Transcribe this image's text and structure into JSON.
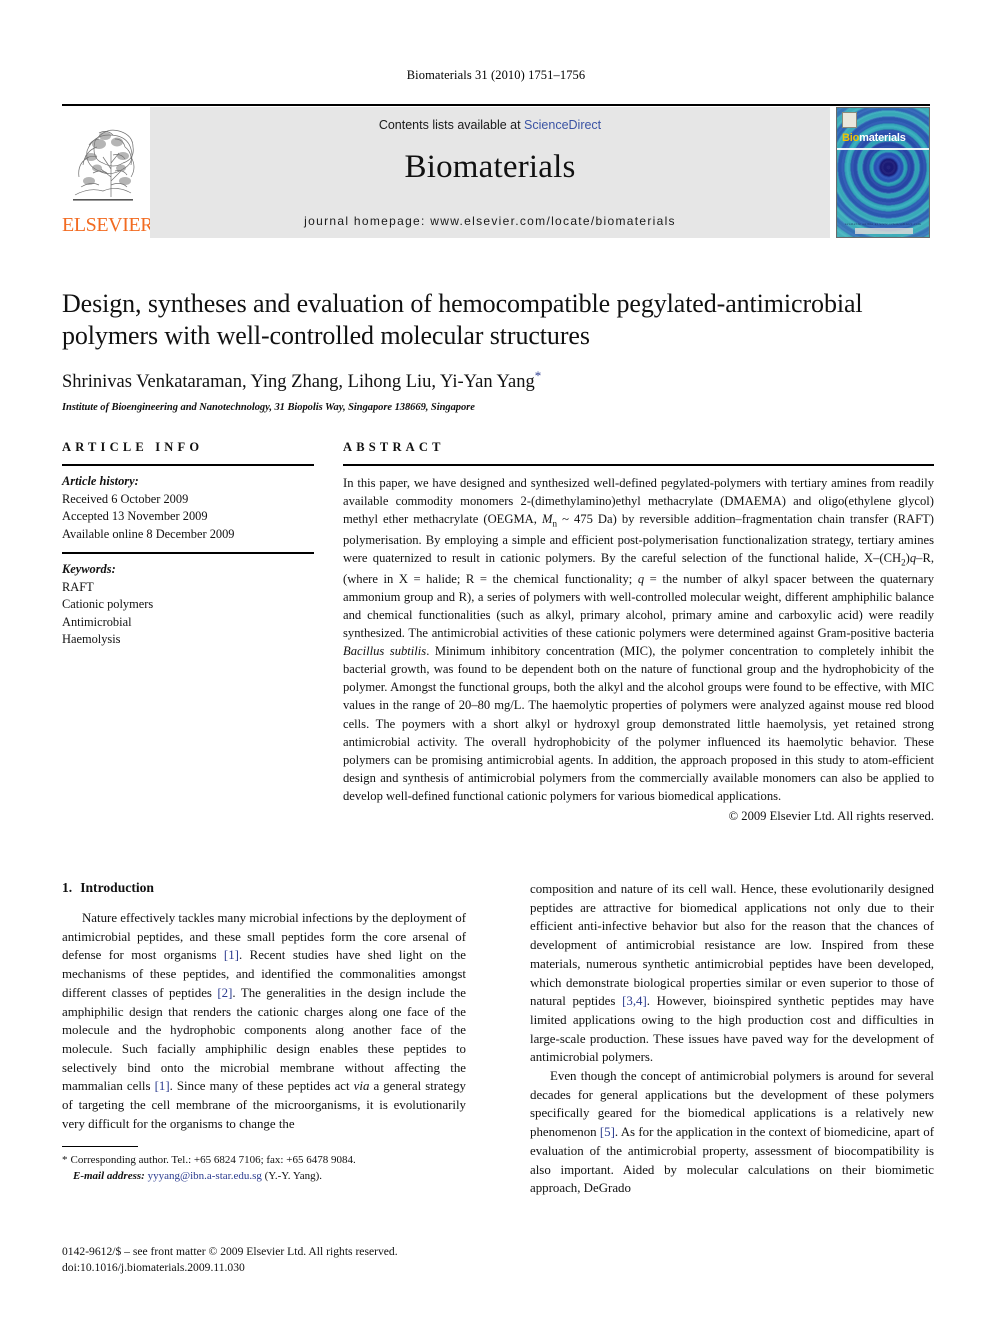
{
  "running_head": "Biomaterials 31 (2010) 1751–1756",
  "masthead": {
    "contents_prefix": "Contents lists available at ",
    "sciencedirect_label": "ScienceDirect",
    "journal_name": "Biomaterials",
    "homepage_label": "journal homepage: www.elsevier.com/locate/biomaterials",
    "publisher_label": "ELSEVIER",
    "cover": {
      "title_part1": "Bio",
      "title_part2": "materials",
      "footer_text": "available online at www.sciencedirect.com"
    },
    "colors": {
      "panel_bg": "#e6e6e6",
      "link": "#3a53a4",
      "elsevier_orange": "#F26B21",
      "cover_teal": "#2f9d9a",
      "cover_gold": "#f2c200"
    }
  },
  "title": "Design, syntheses and evaluation of hemocompatible pegylated-antimicrobial polymers with well-controlled molecular structures",
  "authors": "Shrinivas Venkataraman, Ying Zhang, Lihong Liu, Yi-Yan Yang",
  "corresponding_marker": "*",
  "affiliation": "Institute of Bioengineering and Nanotechnology, 31 Biopolis Way, Singapore 138669, Singapore",
  "article_info": {
    "heading": "ARTICLE INFO",
    "history_label": "Article history:",
    "history": [
      "Received 6 October 2009",
      "Accepted 13 November 2009",
      "Available online 8 December 2009"
    ],
    "keywords_label": "Keywords:",
    "keywords": [
      "RAFT",
      "Cationic polymers",
      "Antimicrobial",
      "Haemolysis"
    ]
  },
  "abstract": {
    "heading": "ABSTRACT",
    "part1": "In this paper, we have designed and synthesized well-defined pegylated-polymers with tertiary amines from readily available commodity monomers 2-(dimethylamino)ethyl methacrylate (DMAEMA) and oligo(ethylene glycol) methyl ether methacrylate (OEGMA, ",
    "mn_symbol": "M",
    "mn_sub": "n",
    "part2": " ~ 475 Da) by reversible addition–fragmentation chain transfer (RAFT) polymerisation. By employing a simple and efficient post-polymerisation functionalization strategy, tertiary amines were quaternized to result in cationic polymers. By the careful selection of the functional halide, X–(CH",
    "ch2_sub": "2",
    "part3": ")",
    "q_italic": "q",
    "part4": "–R, (where in X = halide; R = the chemical functionality; ",
    "q_italic2": "q",
    "part5": " = the number of alkyl spacer between the quaternary ammonium group and R), a series of polymers with well-controlled molecular weight, different amphiphilic balance and chemical functionalities (such as alkyl, primary alcohol, primary amine and carboxylic acid) were readily synthesized. The antimicrobial activities of these cationic polymers were determined against Gram-positive bacteria ",
    "bacillus_italic": "Bacillus subtilis",
    "part6": ". Minimum inhibitory concentration (MIC), the polymer concentration to completely inhibit the bacterial growth, was found to be dependent both on the nature of functional group and the hydrophobicity of the polymer. Amongst the functional groups, both the alkyl and the alcohol groups were found to be effective, with MIC values in the range of 20–80 mg/L. The haemolytic properties of polymers were analyzed against mouse red blood cells. The poymers with a short alkyl or hydroxyl group demonstrated little haemolysis, yet retained strong antimicrobial activity. The overall hydrophobicity of the polymer influenced its haemolytic behavior. These polymers can be promising antimicrobial agents. In addition, the approach proposed in this study to atom-efficient design and synthesis of antimicrobial polymers from the commercially available monomers can also be applied to develop well-defined functional cationic polymers for various biomedical applications.",
    "copyright": "© 2009 Elsevier Ltd. All rights reserved."
  },
  "introduction": {
    "number": "1.",
    "heading": "Introduction",
    "left_paragraph_a": "Nature effectively tackles many microbial infections by the deployment of antimicrobial peptides, and these small peptides form the core arsenal of defense for most organisms ",
    "ref1": "[1]",
    "left_paragraph_b": ". Recent studies have shed light on the mechanisms of these peptides, and identified the commonalities amongst different classes of peptides ",
    "ref2": "[2]",
    "left_paragraph_c": ". The generalities in the design include the amphiphilic design that renders the cationic charges along one face of the molecule and the hydrophobic components along another face of the molecule. Such facially amphiphilic design enables these peptides to selectively bind onto the microbial membrane without affecting the mammalian cells ",
    "ref3": "[1]",
    "left_paragraph_d": ". Since many of these peptides act ",
    "via_italic": "via",
    "left_paragraph_e": " a general strategy of targeting the cell membrane of the microorganisms, it is evolutionarily very difficult for the organisms to change the",
    "right_paragraph_a": "composition and nature of its cell wall. Hence, these evolutionarily designed peptides are attractive for biomedical applications not only due to their efficient anti-infective behavior but also for the reason that the chances of development of antimicrobial resistance are low. Inspired from these materials, numerous synthetic antimicrobial peptides have been developed, which demonstrate biological properties similar or even superior to those of natural peptides ",
    "ref4": "[3,4]",
    "right_paragraph_b": ". However, bioinspired synthetic peptides may have limited applications owing to the high production cost and difficulties in large-scale production. These issues have paved way for the development of antimicrobial polymers.",
    "right_paragraph_c": "Even though the concept of antimicrobial polymers is around for several decades for general applications but the development of these polymers specifically geared for the biomedical applications is a relatively new phenomenon ",
    "ref5": "[5]",
    "right_paragraph_d": ". As for the application in the context of biomedicine, apart of evaluation of the antimicrobial property, assessment of biocompatibility is also important. Aided by molecular calculations on their biomimetic approach, DeGrado"
  },
  "footnote": {
    "star": "*",
    "line1": "Corresponding author. Tel.: +65 6824 7106; fax: +65 6478 9084.",
    "email_label": "E-mail address:",
    "email": "yyyang@ibn.a-star.edu.sg",
    "email_suffix": " (Y.-Y. Yang)."
  },
  "imprint": {
    "line1": "0142-9612/$ – see front matter © 2009 Elsevier Ltd. All rights reserved.",
    "line2": "doi:10.1016/j.biomaterials.2009.11.030"
  }
}
